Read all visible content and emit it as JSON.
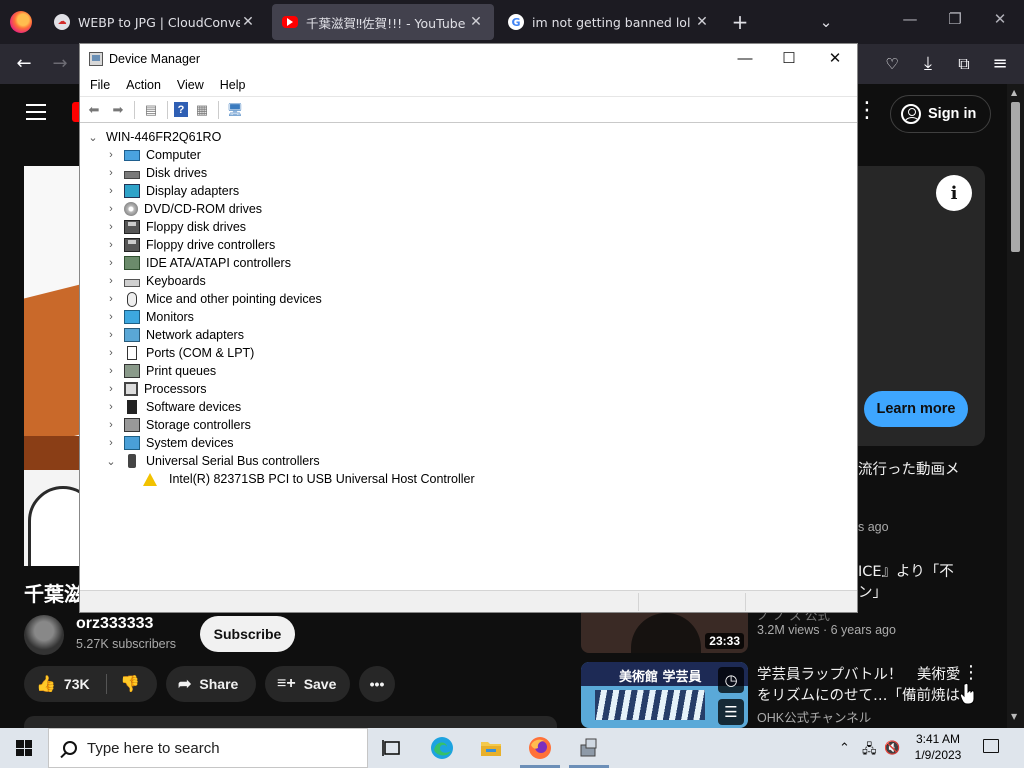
{
  "browser": {
    "tabs": [
      {
        "title": "WEBP to JPG | CloudConvert",
        "active": false
      },
      {
        "title": "千葉滋賀‼佐賀!!! - YouTube",
        "active": true
      },
      {
        "title": "im not getting banned lol - Goo",
        "active": false
      }
    ],
    "new_tab": "+"
  },
  "youtube": {
    "signin_label": "Sign in",
    "learn_more_label": "Learn more",
    "video_title": "千葉滋",
    "channel": {
      "name": "orz333333",
      "subscribers": "5.27K subscribers"
    },
    "subscribe_label": "Subscribe",
    "actions": {
      "likes": "73K",
      "share": "Share",
      "save": "Save"
    },
    "sidebar": {
      "item1_title_partial": "流行った動画メ",
      "item1_meta_partial": "s ago",
      "item2_title_line1_partial": "ICE』より「不",
      "item2_title_line2_partial": "ン」",
      "item2_channel_partial": "ノ ノ ス 公式",
      "item2_duration": "23:33",
      "item2_meta": "3.2M views  ·  6 years ago",
      "item3_title_line1": "学芸員ラップバトル！　美術愛",
      "item3_title_line2": "をリズムにのせて…「備前焼は…",
      "item3_channel": "OHK公式チャンネル",
      "item3_thumb_text": "美術館 学芸員"
    }
  },
  "device_manager": {
    "title": "Device Manager",
    "menu": [
      "File",
      "Action",
      "View",
      "Help"
    ],
    "root": "WIN-446FR2Q61RO",
    "categories": [
      {
        "label": "Computer",
        "icon": "computer-icon",
        "expanded": false
      },
      {
        "label": "Disk drives",
        "icon": "disk-drive-icon",
        "expanded": false
      },
      {
        "label": "Display adapters",
        "icon": "display-adapter-icon",
        "expanded": false
      },
      {
        "label": "DVD/CD-ROM drives",
        "icon": "dvd-drive-icon",
        "expanded": false
      },
      {
        "label": "Floppy disk drives",
        "icon": "floppy-disk-icon",
        "expanded": false
      },
      {
        "label": "Floppy drive controllers",
        "icon": "floppy-controller-icon",
        "expanded": false
      },
      {
        "label": "IDE ATA/ATAPI controllers",
        "icon": "ide-controller-icon",
        "expanded": false
      },
      {
        "label": "Keyboards",
        "icon": "keyboard-icon",
        "expanded": false
      },
      {
        "label": "Mice and other pointing devices",
        "icon": "mouse-icon",
        "expanded": false
      },
      {
        "label": "Monitors",
        "icon": "monitor-icon",
        "expanded": false
      },
      {
        "label": "Network adapters",
        "icon": "network-adapter-icon",
        "expanded": false
      },
      {
        "label": "Ports (COM & LPT)",
        "icon": "port-icon",
        "expanded": false
      },
      {
        "label": "Print queues",
        "icon": "printer-icon",
        "expanded": false
      },
      {
        "label": "Processors",
        "icon": "processor-icon",
        "expanded": false
      },
      {
        "label": "Software devices",
        "icon": "software-device-icon",
        "expanded": false
      },
      {
        "label": "Storage controllers",
        "icon": "storage-controller-icon",
        "expanded": false
      },
      {
        "label": "System devices",
        "icon": "system-device-icon",
        "expanded": false
      },
      {
        "label": "Universal Serial Bus controllers",
        "icon": "usb-icon",
        "expanded": true
      }
    ],
    "usb_child": {
      "label": "Intel(R) 82371SB PCI to USB Universal Host Controller",
      "icon": "warning-icon"
    }
  },
  "taskbar": {
    "search_placeholder": "Type here to search",
    "time": "3:41 AM",
    "date": "1/9/2023"
  },
  "colors": {
    "yt_background": "#0f0f0f",
    "yt_accent": "#3ea6ff",
    "firefox_tabbar": "#1c1b22",
    "taskbar": "#dfe5ec"
  }
}
